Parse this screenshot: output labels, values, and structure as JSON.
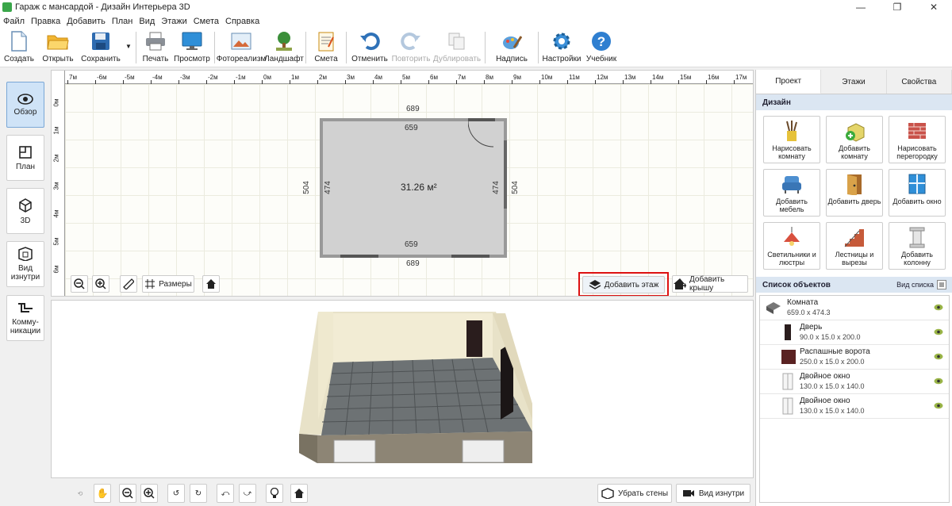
{
  "window": {
    "title": "Гараж с мансардой - Дизайн Интерьера 3D",
    "controls": [
      "—",
      "❐",
      "✕"
    ]
  },
  "menu": [
    "Файл",
    "Правка",
    "Добавить",
    "План",
    "Вид",
    "Этажи",
    "Смета",
    "Справка"
  ],
  "toolbar": {
    "create": "Создать",
    "open": "Открыть",
    "save": "Сохранить",
    "print": "Печать",
    "preview": "Просмотр",
    "photo": "Фотореализм",
    "landscape": "Ландшафт",
    "estimate": "Смета",
    "undo": "Отменить",
    "redo": "Повторить",
    "duplicate": "Дублировать",
    "caption": "Надпись",
    "settings": "Настройки",
    "tutorial": "Учебник"
  },
  "leftbar": {
    "overview": "Обзор",
    "plan": "План",
    "view3d": "3D",
    "inside": "Вид изнутри",
    "comms": "Комму-никации"
  },
  "ruler": {
    "top": [
      "7м",
      "-6м",
      "-5м",
      "-4м",
      "-3м",
      "-2м",
      "-1м",
      "0м",
      "1м",
      "2м",
      "3м",
      "4м",
      "5м",
      "6м",
      "7м",
      "8м",
      "9м",
      "10м",
      "11м",
      "12м",
      "13м",
      "14м",
      "15м",
      "16м",
      "17м"
    ],
    "left": [
      "0м",
      "1м",
      "2м",
      "3м",
      "4м",
      "5м",
      "6м"
    ]
  },
  "plan": {
    "area": "31.26 м²",
    "dim_outer_top": "689",
    "dim_inner_top": "659",
    "dim_inner_bottom": "659",
    "dim_outer_bottom": "689",
    "dim_outer_left": "504",
    "dim_inner_left": "474",
    "dim_inner_right": "474",
    "dim_outer_right": "504",
    "dimensions_btn": "Размеры",
    "add_floor_btn": "Добавить этаж",
    "add_roof_btn": "Добавить крышу"
  },
  "bottom": {
    "remove_walls": "Убрать стены",
    "inside_view": "Вид изнутри"
  },
  "rightpanel": {
    "tabs": [
      "Проект",
      "Этажи",
      "Свойства"
    ],
    "design_header": "Дизайн",
    "design_buttons": [
      "Нарисовать комнату",
      "Добавить комнату",
      "Нарисовать перегородку",
      "Добавить мебель",
      "Добавить дверь",
      "Добавить окно",
      "Светильники и люстры",
      "Лестницы и вырезы",
      "Добавить колонну"
    ],
    "objects_header": "Список объектов",
    "list_view": "Вид списка",
    "objects": [
      {
        "name": "Комната",
        "dims": "659.0 x 474.3"
      },
      {
        "name": "Дверь",
        "dims": "90.0 x 15.0 x 200.0"
      },
      {
        "name": "Распашные ворота",
        "dims": "250.0 x 15.0 x 200.0"
      },
      {
        "name": "Двойное окно",
        "dims": "130.0 x 15.0 x 140.0"
      },
      {
        "name": "Двойное окно",
        "dims": "130.0 x 15.0 x 140.0"
      }
    ]
  }
}
